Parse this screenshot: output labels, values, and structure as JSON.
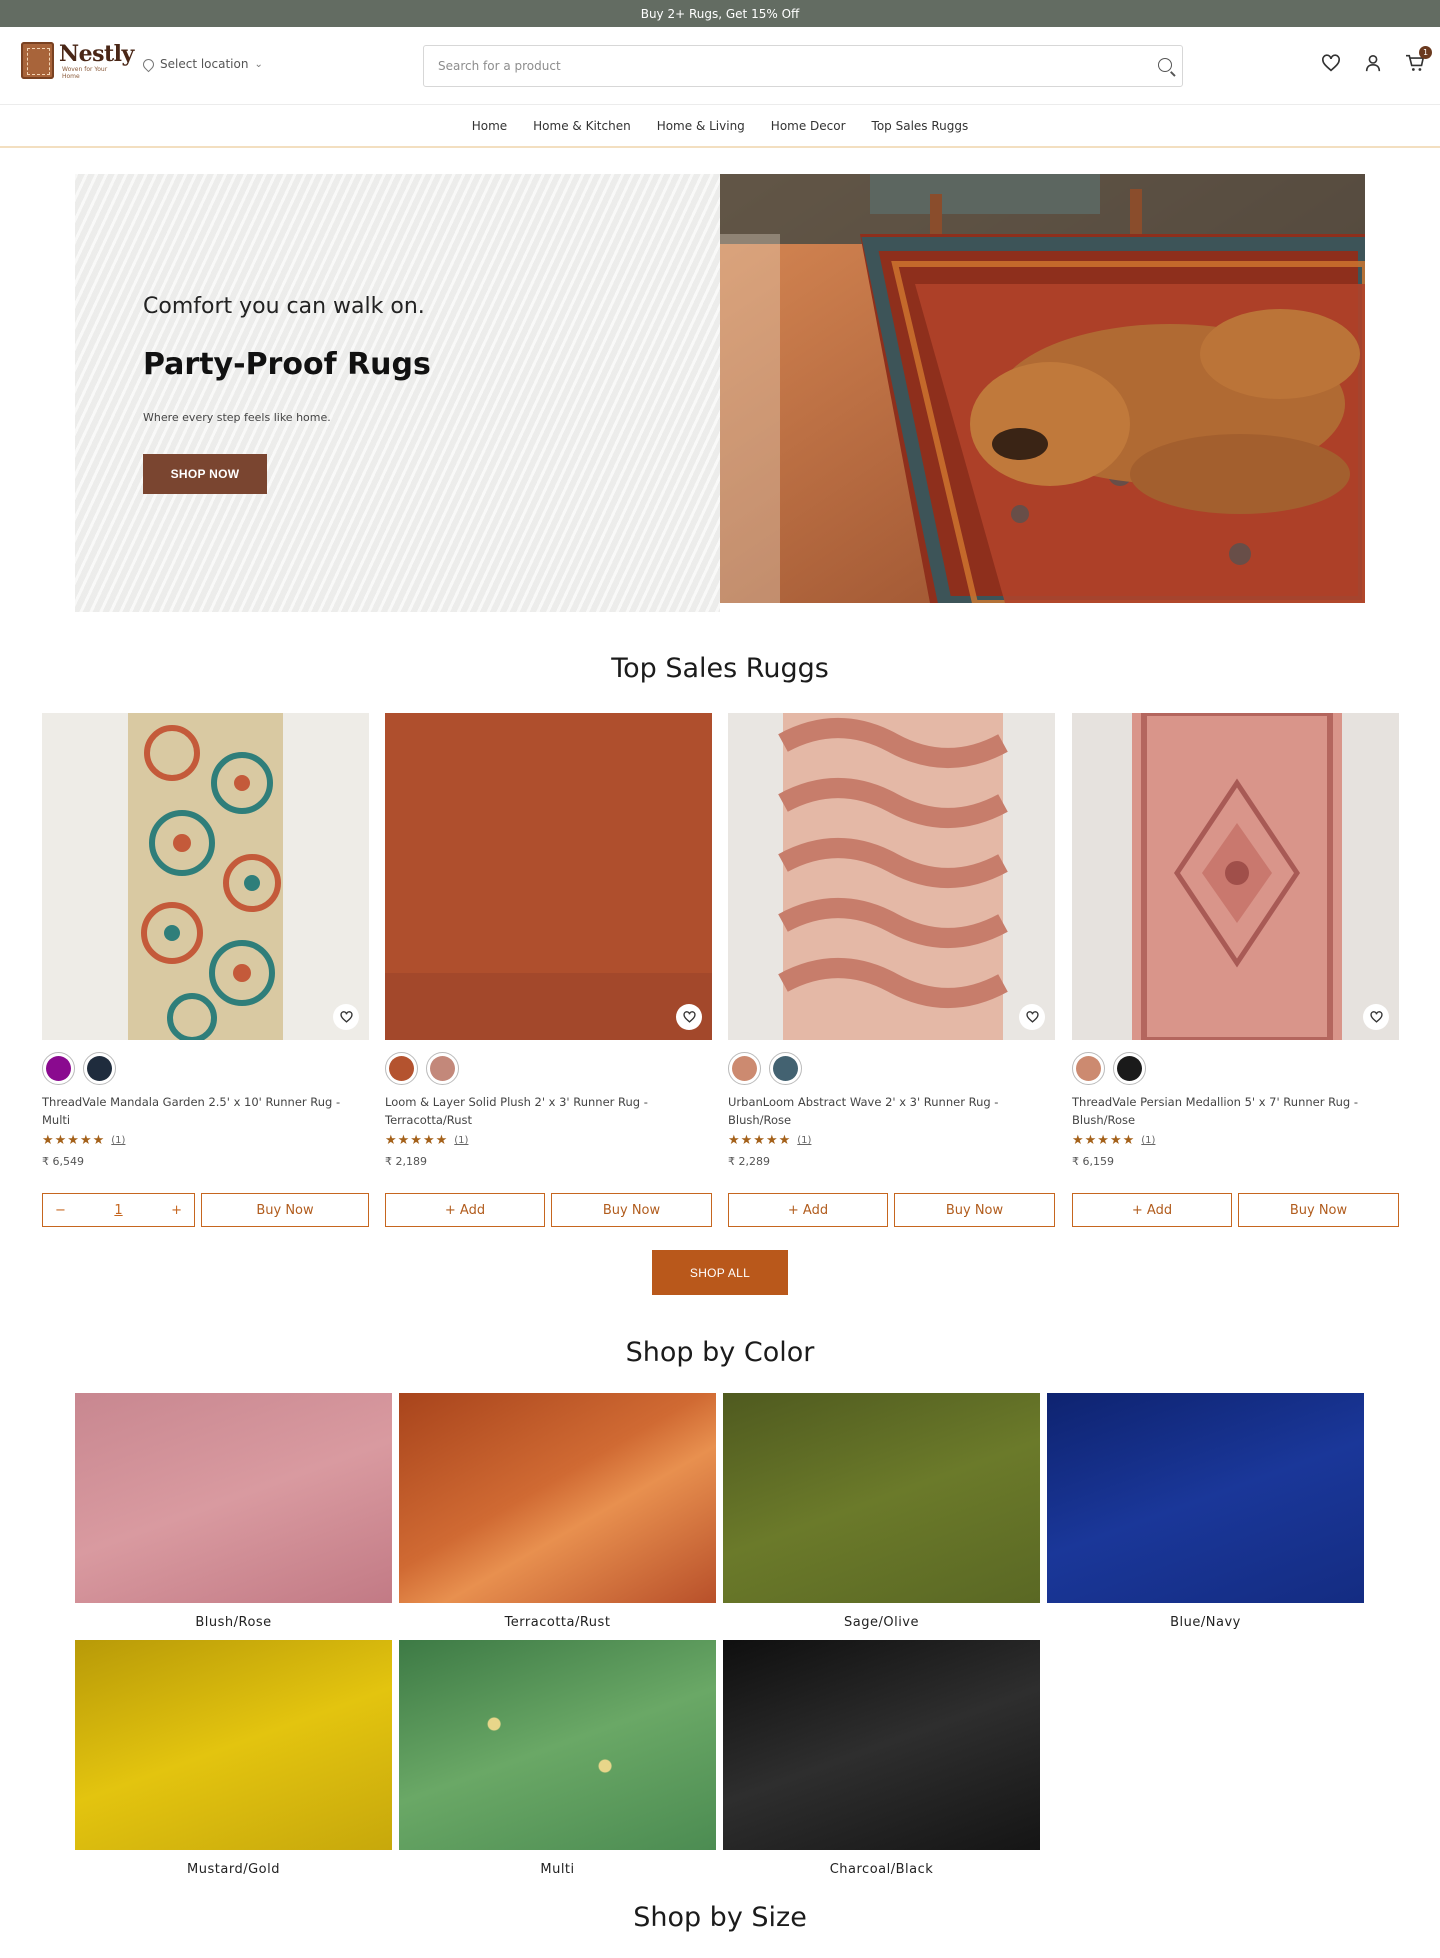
{
  "announcement": "Buy 2+ Rugs, Get 15% Off",
  "header": {
    "logo_name": "Nestly",
    "logo_tagline": "Woven for Your Home",
    "location_label": "Select location",
    "search_placeholder": "Search for a product",
    "cart_count": "1"
  },
  "nav": [
    "Home",
    "Home & Kitchen",
    "Home & Living",
    "Home Decor",
    "Top Sales Ruggs"
  ],
  "hero": {
    "kicker": "Comfort you can walk on.",
    "title": "Party-Proof Rugs",
    "subtitle": "Where every step feels like home.",
    "cta": "SHOP NOW"
  },
  "top_sales": {
    "title": "Top Sales Ruggs",
    "products": [
      {
        "name": "ThreadVale Mandala Garden 2.5' x 10' Runner Rug - Multi",
        "rating_count": "(1)",
        "price": "₹ 6,549",
        "swatches": [
          "#8a0a8f",
          "#1f2c3d"
        ],
        "stars": "★★★★★"
      },
      {
        "name": "Loom & Layer Solid Plush 2' x 3' Runner Rug - Terracotta/Rust",
        "rating_count": "(1)",
        "price": "₹ 2,189",
        "swatches": [
          "#b4532f",
          "#c3887a"
        ],
        "stars": "★★★★★"
      },
      {
        "name": "UrbanLoom Abstract Wave 2' x 3' Runner Rug - Blush/Rose",
        "rating_count": "(1)",
        "price": "₹ 2,289",
        "swatches": [
          "#cc8a70",
          "#436271"
        ],
        "stars": "★★★★★"
      },
      {
        "name": "ThreadVale Persian Medallion 5' x 7' Runner Rug - Blush/Rose",
        "rating_count": "(1)",
        "price": "₹ 6,159",
        "swatches": [
          "#cc8a70",
          "#1a1a1a"
        ],
        "stars": "★★★★★"
      }
    ],
    "qty_value": "1",
    "qty_minus": "−",
    "qty_plus": "+",
    "add_label": "+ Add",
    "buy_label": "Buy Now",
    "shop_all": "SHOP ALL"
  },
  "shop_by_color": {
    "title": "Shop by Color",
    "items": [
      "Blush/Rose",
      "Terracotta/Rust",
      "Sage/Olive",
      "Blue/Navy",
      "Mustard/Gold",
      "Multi",
      "Charcoal/Black"
    ]
  },
  "shop_by_size": {
    "title": "Shop by Size"
  },
  "colors": {
    "accent": "#b9581b",
    "announce_bg": "#636c62",
    "hero_btn": "#7a4530"
  }
}
